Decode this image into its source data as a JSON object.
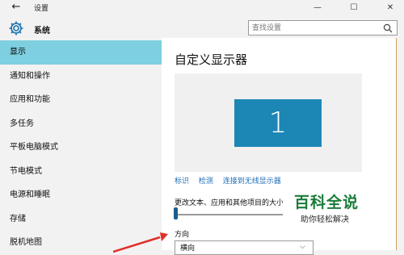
{
  "window": {
    "title": "设置",
    "back_icon": "back-arrow-icon",
    "controls": [
      "—",
      "☐",
      "✕"
    ]
  },
  "sidebar": {
    "header_title": "系统",
    "header_icon": "gear-icon",
    "items": [
      {
        "label": "显示",
        "active": true
      },
      {
        "label": "通知和操作",
        "active": false
      },
      {
        "label": "应用和功能",
        "active": false
      },
      {
        "label": "多任务",
        "active": false
      },
      {
        "label": "平板电脑模式",
        "active": false
      },
      {
        "label": "节电模式",
        "active": false
      },
      {
        "label": "电源和睡眠",
        "active": false
      },
      {
        "label": "存储",
        "active": false
      },
      {
        "label": "脱机地图",
        "active": false
      }
    ]
  },
  "search": {
    "placeholder": "查找设置",
    "icon": "search-icon"
  },
  "main": {
    "title": "自定义显示器",
    "monitor_number": "1",
    "links": [
      "标识",
      "检测",
      "连接到无线显示器"
    ],
    "scale_label": "更改文本、应用和其他项目的大小",
    "scale_value_percent": 0,
    "orientation_label": "方向",
    "orientation_value": "横向"
  },
  "watermark": {
    "title": "百科全说",
    "subtitle": "助你轻松解决"
  },
  "colors": {
    "accent": "#7ecfdf",
    "monitor": "#1c87b5",
    "link": "#1f6fb8",
    "watermark": "#1a7c3a",
    "annotation_arrow": "#e0302a"
  }
}
